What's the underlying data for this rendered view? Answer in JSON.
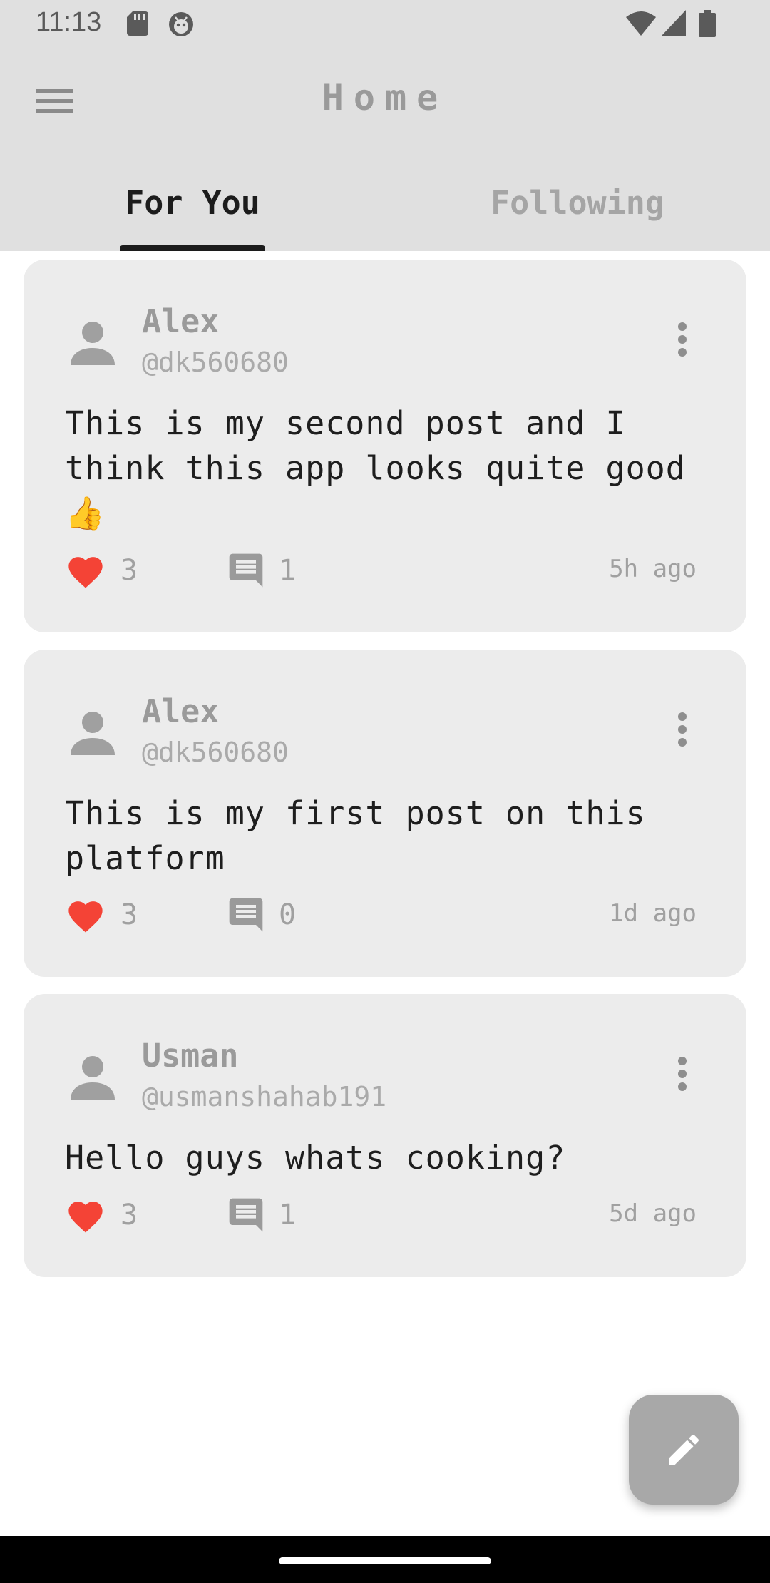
{
  "status_bar": {
    "time": "11:13",
    "left_icons": [
      "sd-card-icon",
      "android-debug-icon"
    ],
    "right_icons": [
      "wifi-icon",
      "cellular-signal-icon",
      "battery-icon"
    ]
  },
  "app_bar": {
    "menu_icon": "hamburger-menu-icon",
    "title": "Home"
  },
  "tabs": [
    {
      "label": "For You",
      "selected": true
    },
    {
      "label": "Following",
      "selected": false
    }
  ],
  "posts": [
    {
      "author_name": "Alex",
      "author_handle": "@dk560680",
      "body": "This is my second post and I think this app looks quite good 👍",
      "likes": "3",
      "comments": "1",
      "time": "5h ago"
    },
    {
      "author_name": "Alex",
      "author_handle": "@dk560680",
      "body": "This is my first post on this platform",
      "likes": "3",
      "comments": "0",
      "time": "1d ago"
    },
    {
      "author_name": "Usman",
      "author_handle": "@usmanshahab191",
      "body": "Hello guys whats cooking?",
      "likes": "3",
      "comments": "1",
      "time": "5d ago"
    }
  ],
  "fab": {
    "icon": "edit-pencil-icon"
  },
  "colors": {
    "app_bar_bg": "#e0e0e0",
    "card_bg": "#ececec",
    "like_red": "#f44336",
    "fab_bg": "#a8a8a8",
    "tab_selected": "#1c1c1c",
    "tab_unselected": "#a5a5a5"
  }
}
